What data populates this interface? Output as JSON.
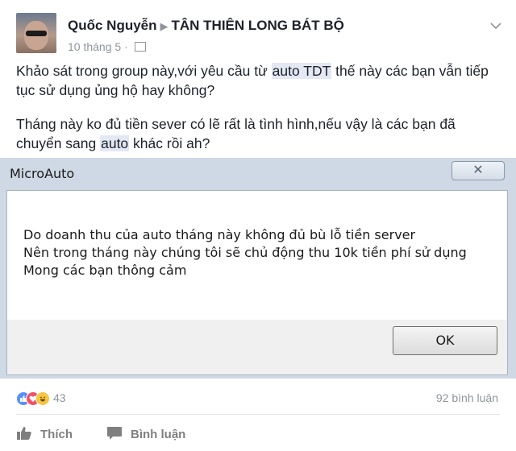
{
  "post": {
    "author": "Quốc Nguyễn",
    "separator": "▶",
    "group": "TÂN THIÊN LONG BÁT BỘ",
    "date": "10 tháng 5",
    "dot": "·",
    "menu_icon": "chevron-down-icon",
    "paragraph1": {
      "before": "Khảo sát trong group này,với yêu cầu từ ",
      "highlight": "auto TDT",
      "after": " thế này các bạn vẫn tiếp tục sử dụng ủng hộ hay không?"
    },
    "paragraph2": {
      "before": "Tháng này ko đủ tiền sever có lẽ rất là tình hình,nếu vậy là các bạn đã chuyển sang ",
      "highlight": "auto",
      "after": " khác rồi ah?"
    }
  },
  "dialog": {
    "title": "MicroAuto",
    "close_label": "✕",
    "lines": [
      "Do doanh thu của auto tháng này không đủ bù lỗ tiền server",
      "Nên trong tháng này chúng tôi sẽ chủ động thu 10k tiền phí sử dụng",
      "Mong các bạn thông cảm"
    ],
    "ok_label": "OK"
  },
  "footer": {
    "reaction_count": "43",
    "comment_count": "92 bình luận",
    "like_label": "Thích",
    "comment_label": "Bình luận"
  },
  "colors": {
    "highlight_bg": "#e3e8f4",
    "meta_gray": "#90949c",
    "like_blue": "#5890ff",
    "love_red": "#f25268",
    "haha_yellow": "#f7c53f"
  }
}
